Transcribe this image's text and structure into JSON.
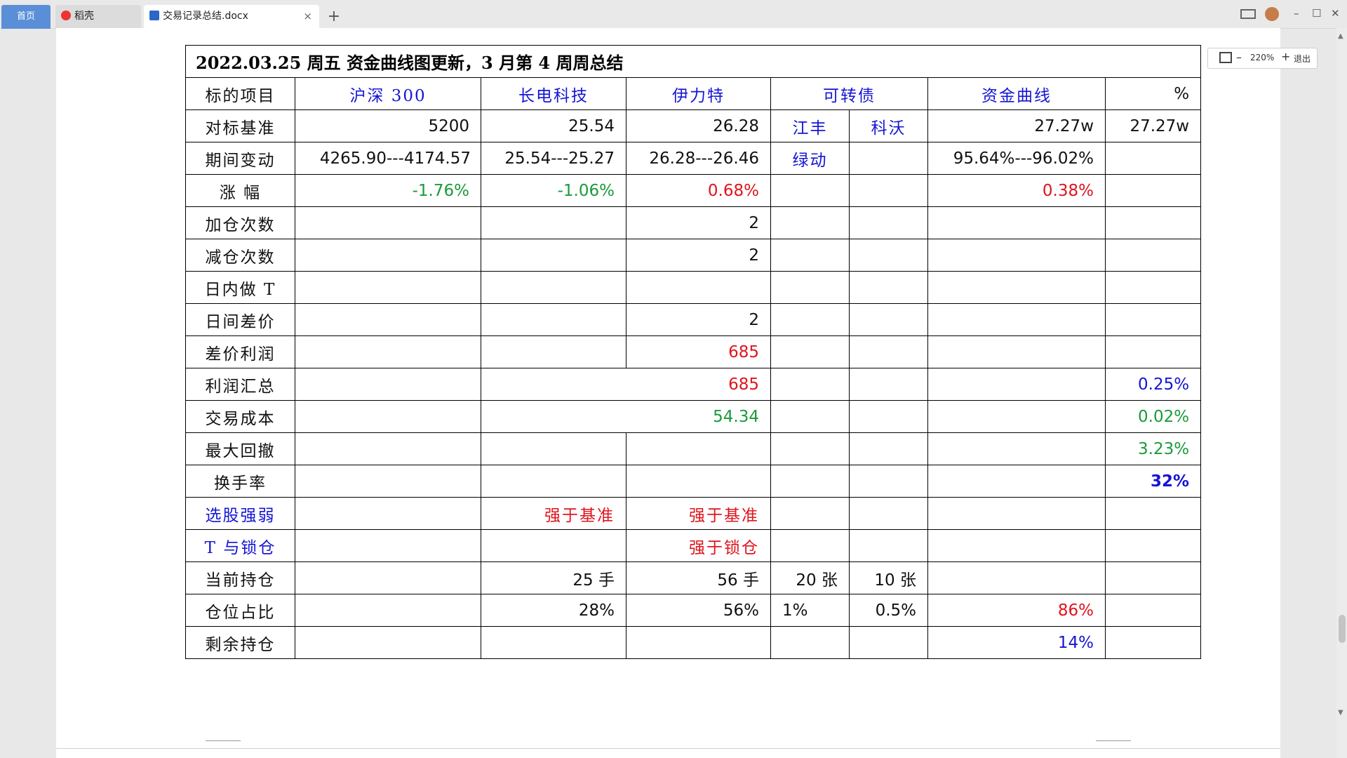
{
  "tabs": {
    "home": "首页",
    "docer": "稻壳",
    "doc": "交易记录总结.docx",
    "add": "+",
    "close": "×"
  },
  "window": {
    "minimize": "–",
    "maximize": "☐",
    "close": "✕"
  },
  "zoom": {
    "value": "220%",
    "minus": "–",
    "plus": "+",
    "exit": "退出"
  },
  "table": {
    "title": "2022.03.25  周五  资金曲线图更新，3 月第 4 周周总结",
    "header": {
      "label": "标的项目",
      "hs300": "沪深 300",
      "cdkj": "长电科技",
      "ylt": "伊力特",
      "kzz": "可转债",
      "zjqx": "资金曲线",
      "pct": "%"
    },
    "rows": {
      "benchmark": {
        "label": "对标基准",
        "hs300": "5200",
        "cdkj": "25.54",
        "ylt": "26.28",
        "jf": "江丰",
        "kw": "科沃",
        "zjqx": "27.27w",
        "pct": "27.27w"
      },
      "change": {
        "label": "期间变动",
        "hs300": "4265.90---4174.57",
        "cdkj": "25.54---25.27",
        "ylt": "26.28---26.46",
        "jf": "绿动",
        "zjqx": "95.64%---96.02%"
      },
      "rise": {
        "label": "涨  幅",
        "hs300": "-1.76%",
        "cdkj": "-1.06%",
        "ylt": "0.68%",
        "zjqx": "0.38%"
      },
      "add_times": {
        "label": "加仓次数",
        "ylt": "2"
      },
      "reduce_times": {
        "label": "减仓次数",
        "ylt": "2"
      },
      "intraday_t": {
        "label": "日内做 T"
      },
      "interday_spread": {
        "label": "日间差价",
        "ylt": "2"
      },
      "spread_profit": {
        "label": "差价利润",
        "ylt": "685"
      },
      "profit_total": {
        "label": "利润汇总",
        "value": "685",
        "pct": "0.25%"
      },
      "trade_cost": {
        "label": "交易成本",
        "value": "54.34",
        "pct": "0.02%"
      },
      "max_drawdown": {
        "label": "最大回撤",
        "pct": "3.23%"
      },
      "turnover": {
        "label": "换手率",
        "pct": "32%"
      },
      "stock_strength": {
        "label": "选股强弱",
        "cdkj": "强于基准",
        "ylt": "强于基准"
      },
      "t_vs_lock": {
        "label": "T 与锁仓",
        "ylt": "强于锁仓"
      },
      "holdings": {
        "label": "当前持仓",
        "cdkj": "25 手",
        "ylt": "56 手",
        "jf": "20 张",
        "kw": "10 张"
      },
      "position_ratio": {
        "label": "仓位占比",
        "cdkj": "28%",
        "ylt": "56%",
        "jf": "1%",
        "kw": "0.5%",
        "zjqx": "86%"
      },
      "remaining": {
        "label": "剩余持仓",
        "zjqx": "14%"
      }
    }
  }
}
